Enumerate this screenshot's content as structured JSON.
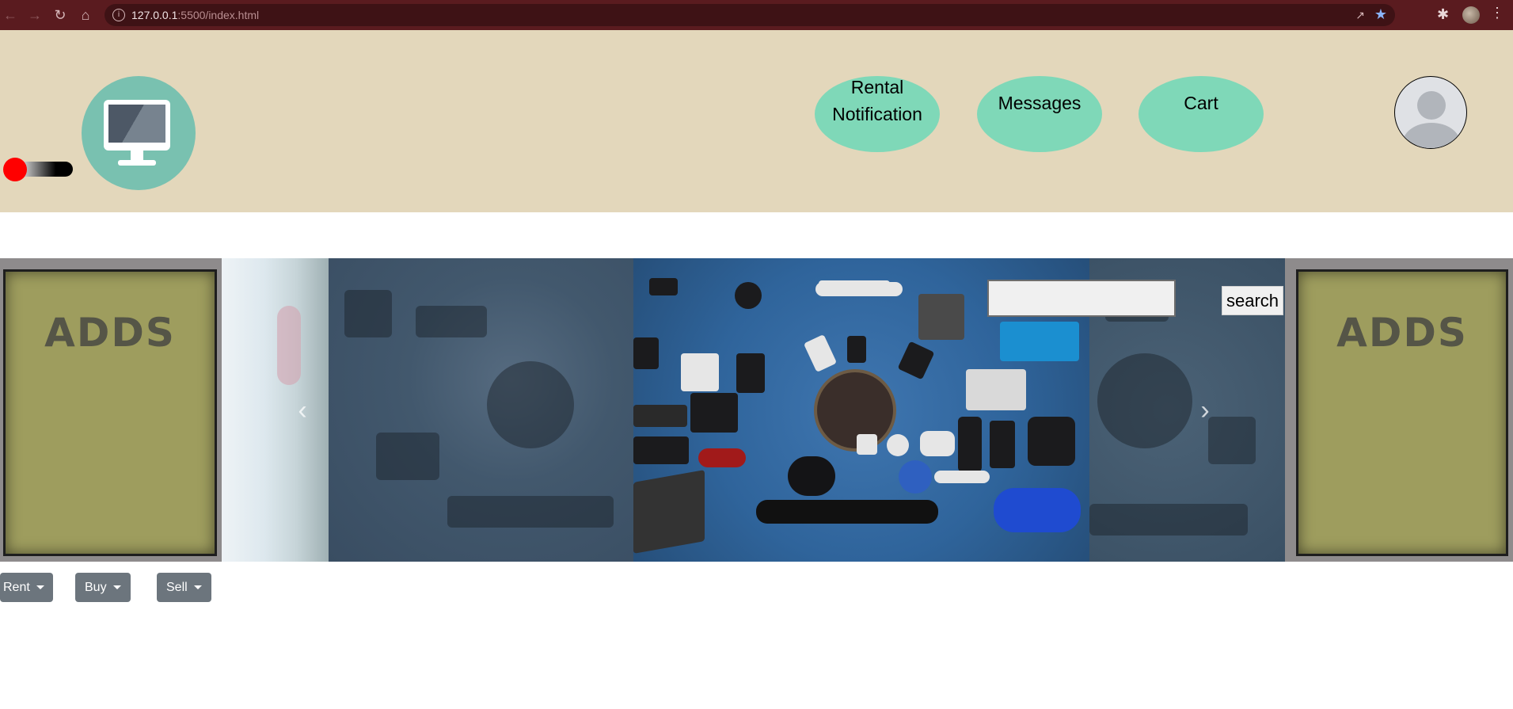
{
  "browser": {
    "url_host": "127.0.0.1",
    "url_rest": ":5500/index.html",
    "icons": [
      "back-arrow-icon",
      "forward-arrow-icon",
      "reload-icon",
      "home-icon",
      "info-icon",
      "share-icon",
      "star-icon",
      "extensions-icon",
      "profile-avatar-icon",
      "kebab-menu-icon"
    ]
  },
  "header": {
    "nav": [
      {
        "label_line1": "Rental",
        "label_line2": "Notification"
      },
      {
        "label": "Messages"
      },
      {
        "label": "Cart"
      }
    ],
    "theme_toggle_colors": {
      "knob": "#ff0000",
      "track_start": "#ffffff",
      "track_end": "#000000"
    },
    "background": "#e3d7bb",
    "accent": "#7fd8b8"
  },
  "ads": {
    "left_label": "ADDS",
    "right_label": "ADDS"
  },
  "carousel": {
    "prev_icon": "chevron-left-icon",
    "next_icon": "chevron-right-icon"
  },
  "search": {
    "value": "",
    "placeholder": "",
    "button_label": "search"
  },
  "menus": {
    "rent": "Rent",
    "buy": "Buy",
    "sell": "Sell"
  }
}
